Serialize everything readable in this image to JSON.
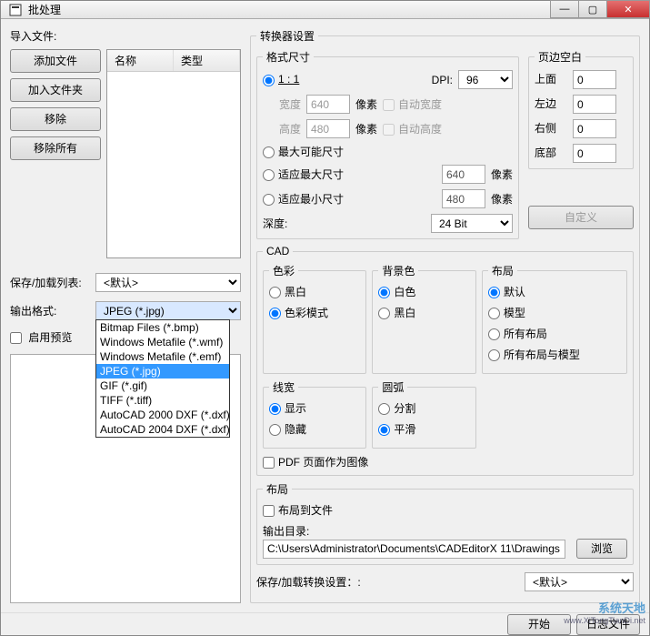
{
  "window": {
    "title": "批处理"
  },
  "left": {
    "import_label": "导入文件:",
    "btn_add_file": "添加文件",
    "btn_add_folder": "加入文件夹",
    "btn_remove": "移除",
    "btn_remove_all": "移除所有",
    "col_name": "名称",
    "col_type": "类型",
    "save_list_label": "保存/加载列表:",
    "save_list_value": "<默认>",
    "output_format_label": "输出格式:",
    "output_format_value": "JPEG (*.jpg)",
    "dropdown_items": [
      "Bitmap Files (*.bmp)",
      "Windows Metafile (*.wmf)",
      "Windows Metafile (*.emf)",
      "JPEG (*.jpg)",
      "GIF (*.gif)",
      "TIFF (*.tiff)",
      "AutoCAD 2000 DXF (*.dxf)",
      "AutoCAD 2004 DXF (*.dxf)"
    ],
    "enable_preview": "启用预览"
  },
  "right": {
    "converter_settings": "转换器设置",
    "format_size": "格式尺寸",
    "one_to_one": "1 : 1",
    "dpi_label": "DPI:",
    "dpi_value": "96",
    "width_label": "宽度",
    "width_value": "640",
    "px1": "像素",
    "auto_width": "自动宽度",
    "height_label": "高度",
    "height_value": "480",
    "px2": "像素",
    "auto_height": "自动高度",
    "max_possible": "最大可能尺寸",
    "fit_max": "适应最大尺寸",
    "fit_max_v": "640",
    "fit_max_px": "像素",
    "fit_min": "适应最小尺寸",
    "fit_min_v": "480",
    "fit_min_px": "像素",
    "depth_label": "深度:",
    "depth_value": "24 Bit",
    "margins": "页边空白",
    "top": "上面",
    "top_v": "0",
    "left_m": "左边",
    "left_v": "0",
    "right_m": "右侧",
    "right_v": "0",
    "bottom": "底部",
    "bottom_v": "0",
    "custom": "自定义",
    "cad": "CAD",
    "color": "色彩",
    "color_bw": "黑白",
    "color_mode": "色彩模式",
    "bgcolor": "背景色",
    "bg_white": "白色",
    "bg_black": "黑白",
    "layout": "布局",
    "layout_default": "默认",
    "layout_model": "模型",
    "layout_all": "所有布局",
    "layout_all_model": "所有布局与模型",
    "linew": "线宽",
    "lw_show": "显示",
    "lw_hide": "隐藏",
    "arc": "圆弧",
    "arc_split": "分割",
    "arc_smooth": "平滑",
    "pdf_as_image": "PDF 页面作为图像",
    "layout_section": "布局",
    "layout_to_file": "布局到文件",
    "output_dir_label": "输出目录:",
    "output_dir_value": "C:\\Users\\Administrator\\Documents\\CADEditorX 11\\Drawings",
    "browse": "浏览",
    "save_convert_label": "保存/加载转换设置：:",
    "save_convert_value": "<默认>"
  },
  "footer": {
    "start": "开始",
    "log": "日志文件"
  },
  "watermark": {
    "line1": "系统天地",
    "line2": "www.XiTongTianDi.net"
  }
}
